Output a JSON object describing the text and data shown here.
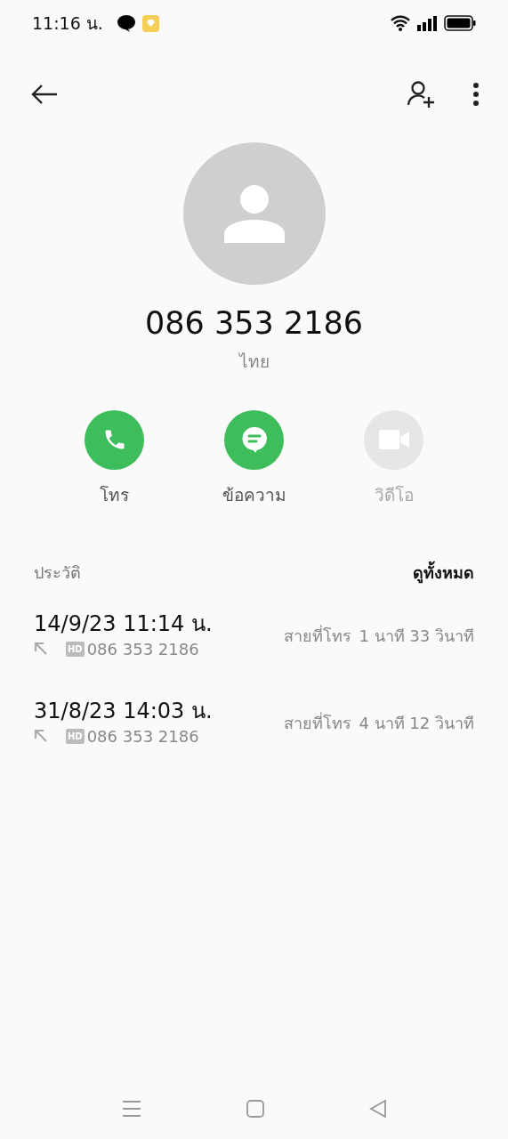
{
  "status_bar": {
    "time": "11:16 น."
  },
  "contact": {
    "number": "086 353 2186",
    "location": "ไทย"
  },
  "actions": [
    {
      "kind": "call",
      "label": "โทร",
      "disabled": false
    },
    {
      "kind": "message",
      "label": "ข้อความ",
      "disabled": false
    },
    {
      "kind": "video",
      "label": "วิดีโอ",
      "disabled": true
    }
  ],
  "history": {
    "title": "ประวัติ",
    "see_all": "ดูทั้งหมด",
    "entries": [
      {
        "datetime": "14/9/23 11:14 น.",
        "badge": "HD",
        "number": "086 353 2186",
        "type": "สายที่โทร",
        "duration": "1 นาที 33 วินาที"
      },
      {
        "datetime": "31/8/23 14:03 น.",
        "badge": "HD",
        "number": "086 353 2186",
        "type": "สายที่โทร",
        "duration": "4 นาที 12 วินาที"
      }
    ]
  }
}
